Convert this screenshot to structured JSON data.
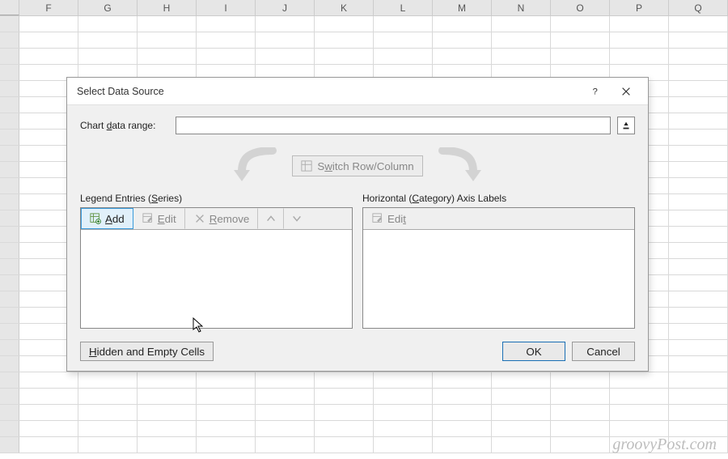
{
  "spreadsheet": {
    "columns": [
      "F",
      "G",
      "H",
      "I",
      "J",
      "K",
      "L",
      "M",
      "N",
      "O",
      "P",
      "Q"
    ]
  },
  "dialog": {
    "title": "Select Data Source",
    "range_label_pre": "Chart ",
    "range_label_u": "d",
    "range_label_post": "ata range:",
    "range_value": "",
    "switch_pre": "S",
    "switch_u": "w",
    "switch_post": "itch Row/Column",
    "legend_title_pre": "Legend Entries (",
    "legend_title_u": "S",
    "legend_title_post": "eries)",
    "axis_title_pre": "Horizontal (",
    "axis_title_u": "C",
    "axis_title_post": "ategory) Axis Labels",
    "add_u": "A",
    "add_post": "dd",
    "edit_pre": "",
    "edit_u": "E",
    "edit_post": "dit",
    "remove_u": "R",
    "remove_post": "emove",
    "axis_edit_pre": "Edi",
    "axis_edit_u": "t",
    "axis_edit_post": "",
    "hidden_pre": "",
    "hidden_u": "H",
    "hidden_post": "idden and Empty Cells",
    "ok": "OK",
    "cancel": "Cancel"
  },
  "watermark": "groovyPost.com"
}
